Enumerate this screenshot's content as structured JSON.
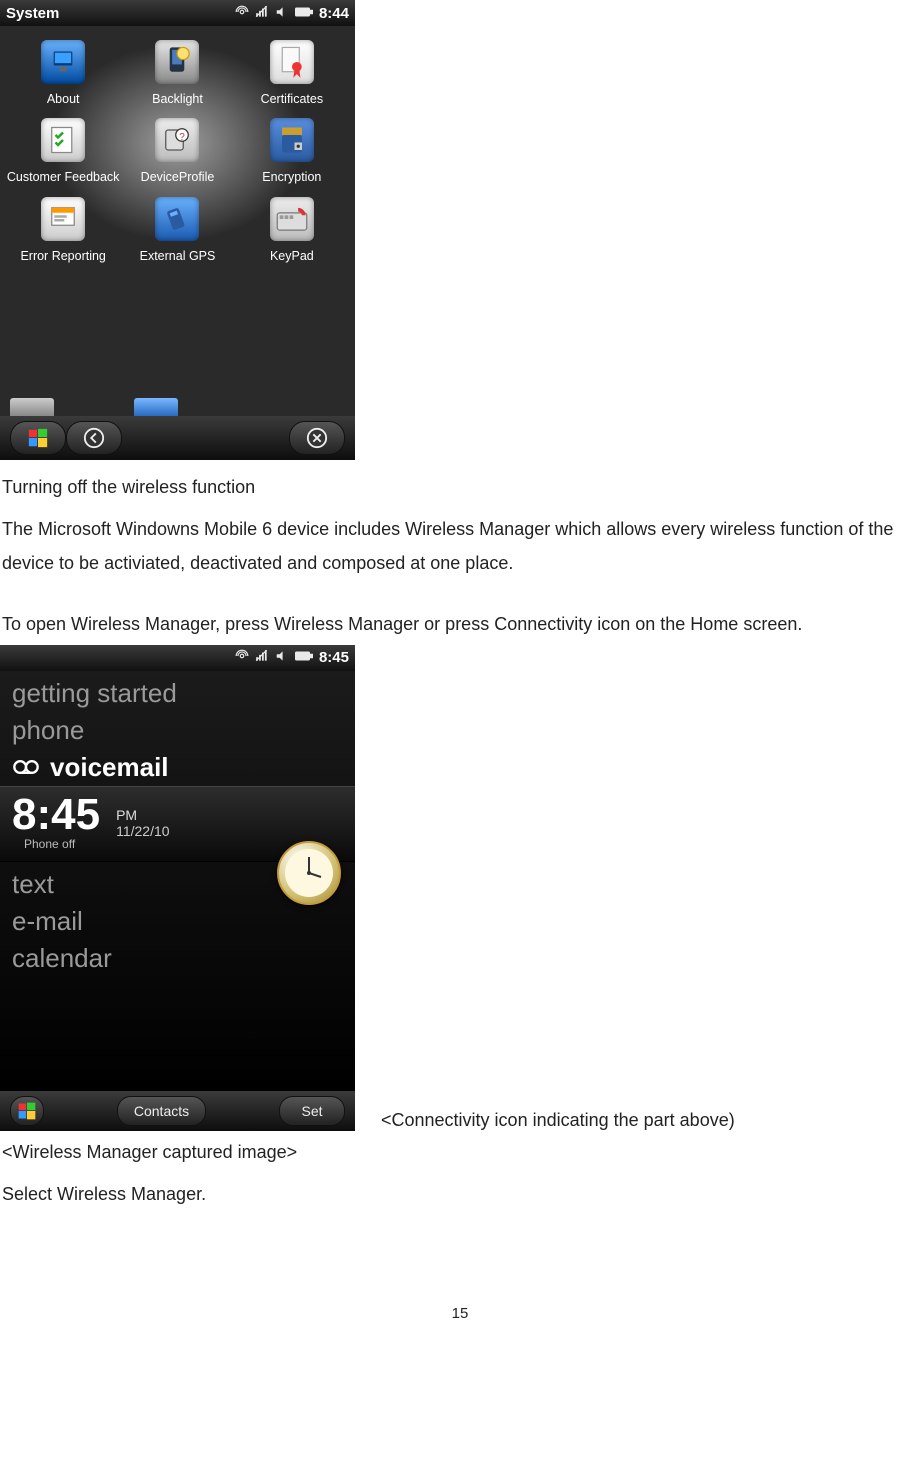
{
  "page_number": "15",
  "screenshot1": {
    "statusbar_title": "System",
    "time": "8:44",
    "icons": [
      {
        "name": "about-icon",
        "label": "About"
      },
      {
        "name": "backlight-icon",
        "label": "Backlight"
      },
      {
        "name": "certificates-icon",
        "label": "Certificates"
      },
      {
        "name": "customer-feedback-icon",
        "label": "Customer Feedback"
      },
      {
        "name": "device-profile-icon",
        "label": "DeviceProfile"
      },
      {
        "name": "encryption-icon",
        "label": "Encryption"
      },
      {
        "name": "error-reporting-icon",
        "label": "Error Reporting"
      },
      {
        "name": "external-gps-icon",
        "label": "External GPS"
      },
      {
        "name": "keypad-icon",
        "label": "KeyPad"
      }
    ]
  },
  "text": {
    "heading1": "Turning off the wireless function",
    "para1": "The Microsoft Windowns Mobile 6 device includes Wireless Manager which allows every wireless function of the device to be activiated, deactivated and composed at one place.",
    "para2": "To open Wireless Manager, press Wireless Manager or press Connectivity icon on the Home screen.",
    "caption_right": "<Connectivity icon indicating the part above)",
    "caption_below": "<Wireless Manager captured image>",
    "instruction": "Select Wireless Manager."
  },
  "screenshot2": {
    "time": "8:45",
    "menu": {
      "getting_started": "getting started",
      "phone": "phone",
      "voicemail": "voicemail",
      "text": "text",
      "email": "e-mail",
      "calendar": "calendar"
    },
    "bigtime": "8:45",
    "ampm": "PM",
    "date": "11/22/10",
    "phone_off": "Phone off",
    "softkey_left": "Contacts",
    "softkey_right": "Set"
  }
}
